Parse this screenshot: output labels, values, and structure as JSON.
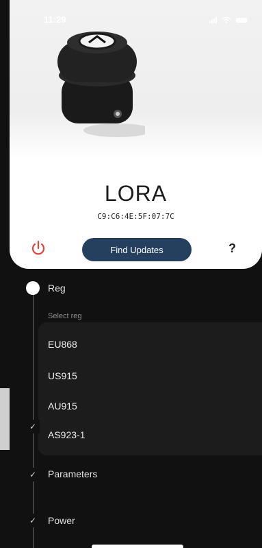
{
  "status": {
    "time": "11:29"
  },
  "device": {
    "name": "LORA",
    "mac": "C9:C6:4E:5F:07:7C"
  },
  "actions": {
    "find_updates": "Find Updates",
    "help": "?"
  },
  "steps": {
    "reg": {
      "label": "Reg",
      "select_label": "Select reg",
      "options": [
        "EU868",
        "US915",
        "AU915",
        "AS923-1"
      ]
    },
    "parameters": {
      "label": "Parameters"
    },
    "power": {
      "label": "Power"
    }
  },
  "colors": {
    "accent": "#25405f",
    "power_icon": "#e0443a"
  }
}
